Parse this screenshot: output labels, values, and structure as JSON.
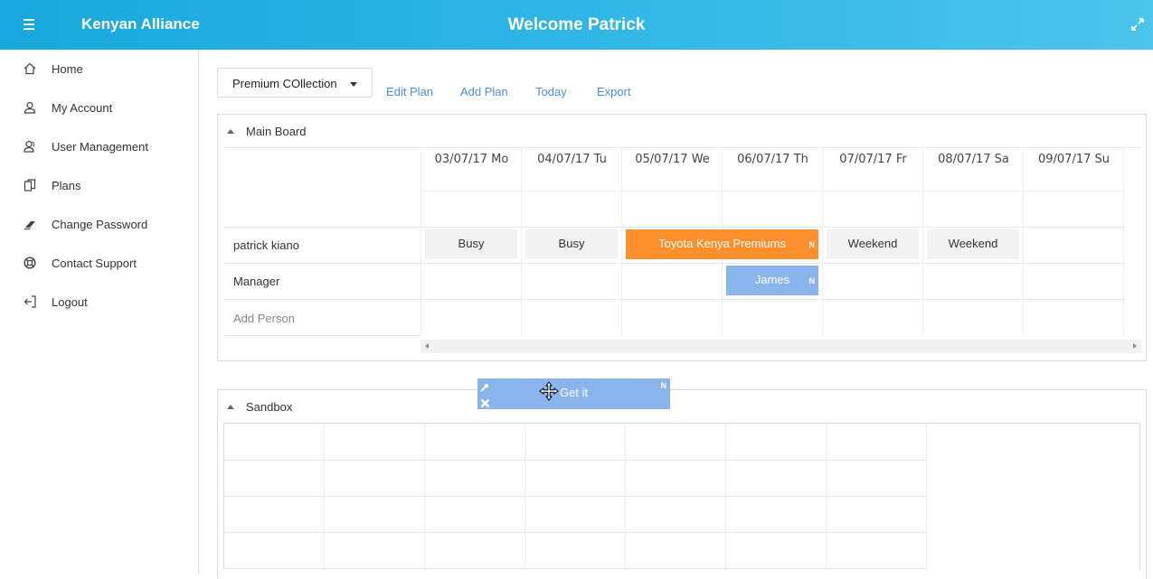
{
  "header": {
    "brand": "Kenyan Alliance",
    "welcome": "Welcome Patrick",
    "menu_icon": "hamburger-icon",
    "expand_icon": "expand-icon",
    "background_color": "#2fb6e6"
  },
  "sidebar": {
    "items": [
      {
        "label": "Home",
        "icon": "home-icon"
      },
      {
        "label": "My Account",
        "icon": "user-icon"
      },
      {
        "label": "User Management",
        "icon": "users-icon"
      },
      {
        "label": "Plans",
        "icon": "copy-icon"
      },
      {
        "label": "Change Password",
        "icon": "eraser-icon"
      },
      {
        "label": "Contact Support",
        "icon": "lifebuoy-icon"
      },
      {
        "label": "Logout",
        "icon": "logout-icon"
      }
    ]
  },
  "toolbar": {
    "plan_select": "Premium COllection",
    "edit_plan": "Edit Plan",
    "add_plan": "Add Plan",
    "today": "Today",
    "export": "Export",
    "link_color": "#4a90d9"
  },
  "main_board": {
    "title": "Main Board",
    "columns": [
      "03/07/17 Mo",
      "04/07/17 Tu",
      "05/07/17 We",
      "06/07/17 Th",
      "07/07/17 Fr",
      "08/07/17 Sa",
      "09/07/17 Su"
    ],
    "rows": [
      "patrick kiano",
      "Manager"
    ],
    "add_person": "Add Person",
    "cells": {
      "busy_1": "Busy",
      "busy_2": "Busy",
      "weekend_1": "Weekend",
      "weekend_2": "Weekend"
    },
    "events": {
      "toyota": {
        "label": "Toyota Kenya Premiums",
        "badge": "N",
        "color": "#fd8f2c"
      },
      "james": {
        "label": "James",
        "badge": "N",
        "color": "#8ab4ec"
      }
    }
  },
  "sandbox": {
    "title": "Sandbox"
  },
  "drag_item": {
    "label": "Get it",
    "badge": "N",
    "color": "#8ab4ec"
  }
}
